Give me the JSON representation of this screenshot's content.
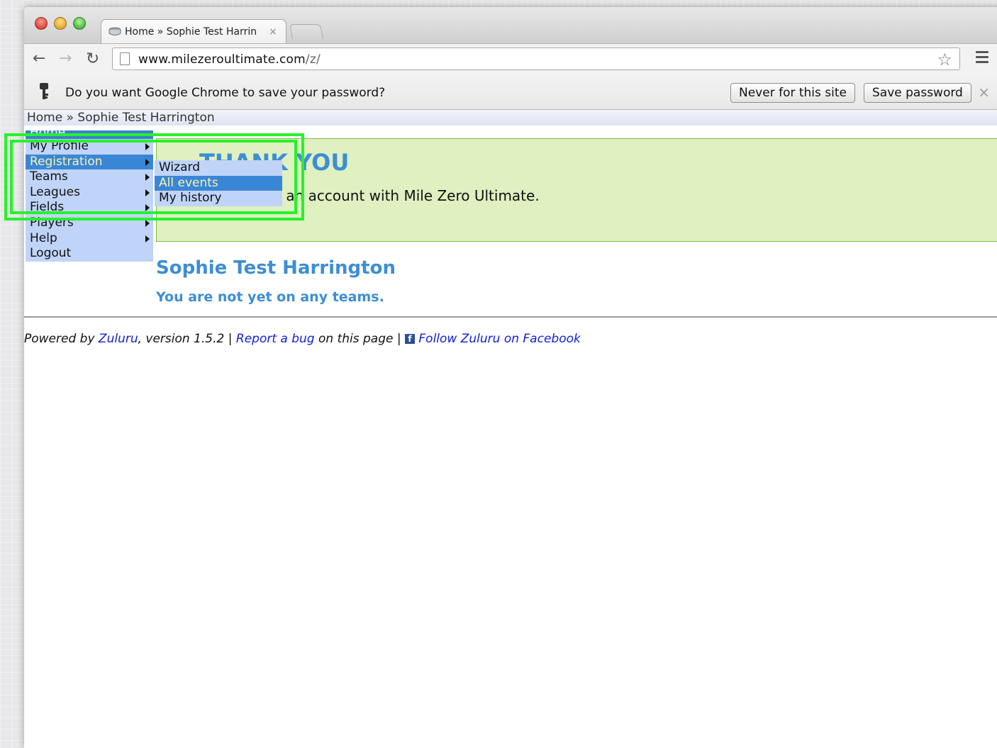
{
  "tab": {
    "title": "Home » Sophie Test Harrin",
    "close": "×"
  },
  "toolbar": {
    "url_host": "www.milezeroultimate.com",
    "url_path": "/z/"
  },
  "infobar": {
    "message": "Do you want Google Chrome to save your password?",
    "never_label": "Never for this site",
    "save_label": "Save password",
    "close": "×"
  },
  "breadcrumb": "Home » Sophie Test Harrington",
  "menu": {
    "items": [
      {
        "label": "Home"
      },
      {
        "label": "My Profile"
      },
      {
        "label": "Registration"
      },
      {
        "label": "Teams"
      },
      {
        "label": "Leagues"
      },
      {
        "label": "Fields"
      },
      {
        "label": "Players"
      },
      {
        "label": "Help"
      },
      {
        "label": "Logout"
      }
    ],
    "submenu": [
      {
        "label": "Wizard"
      },
      {
        "label": "All events"
      },
      {
        "label": "My history"
      }
    ]
  },
  "thanks": {
    "heading": "THANK YOU",
    "message": "for creating an account with Mile Zero Ultimate."
  },
  "profile": {
    "name": "Sophie Test Harrington",
    "teams_note": "You are not yet on any teams."
  },
  "footer": {
    "powered_by": "Powered by ",
    "zuluru": "Zuluru",
    "version": ", version 1.5.2 | ",
    "report_bug": "Report a bug",
    "on_page": " on this page | ",
    "follow": "Follow Zuluru on Facebook"
  },
  "colors": {
    "accent": "#3d8ed4",
    "menu_bg": "#bfd4f8",
    "menu_active": "#3a86d6",
    "highlight": "#26f22a"
  }
}
